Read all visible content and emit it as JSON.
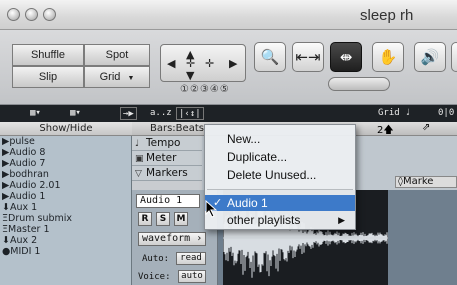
{
  "window": {
    "title": "sleep rh"
  },
  "toolbar": {
    "modes": [
      "Shuffle",
      "Spot",
      "Slip",
      "Grid"
    ],
    "counter_digits": [
      "1",
      "2",
      "3",
      "4",
      "5"
    ]
  },
  "edit_bar": {
    "grid_label": "Grid",
    "zoom_text": "a..z",
    "readout": "0|0"
  },
  "tracks_panel": {
    "header": "Show/Hide",
    "tracks": [
      {
        "label": "pulse",
        "prefix": "▶"
      },
      {
        "label": "Audio 8",
        "prefix": "▶"
      },
      {
        "label": "Audio 7",
        "prefix": "▶"
      },
      {
        "label": "bodhran",
        "prefix": "▶"
      },
      {
        "label": "Audio 2.01",
        "prefix": "▶"
      },
      {
        "label": "Audio 1",
        "prefix": "▶"
      },
      {
        "label": "Aux 1",
        "prefix": "⬇"
      },
      {
        "label": "Drum submix",
        "prefix": "Ξ"
      },
      {
        "label": "Master 1",
        "prefix": "Ξ"
      },
      {
        "label": "Aux 2",
        "prefix": "⬇"
      },
      {
        "label": "MIDI 1",
        "prefix": "●"
      }
    ]
  },
  "rulers": {
    "bars_beats": "Bars:Beats",
    "bar_number": "2",
    "rows": [
      "Tempo",
      "Meter",
      "Markers"
    ],
    "markers_tab": "Marke"
  },
  "track": {
    "name": "Audio 1",
    "buttons": [
      "R",
      "S",
      "M"
    ],
    "view": "waveform",
    "auto_label": "Auto:",
    "auto_value": "read",
    "voice_label": "Voice:",
    "voice_value": "auto"
  },
  "context_menu": {
    "items": [
      "New...",
      "Duplicate...",
      "Delete Unused..."
    ],
    "current_playlist": "Audio 1",
    "submenu": "other playlists"
  },
  "colors": {
    "highlight": "#3d7ac9",
    "dark_bar": "#1e2226",
    "track_list_bg": "#b4c1cb",
    "region": "#6f7f8e"
  }
}
